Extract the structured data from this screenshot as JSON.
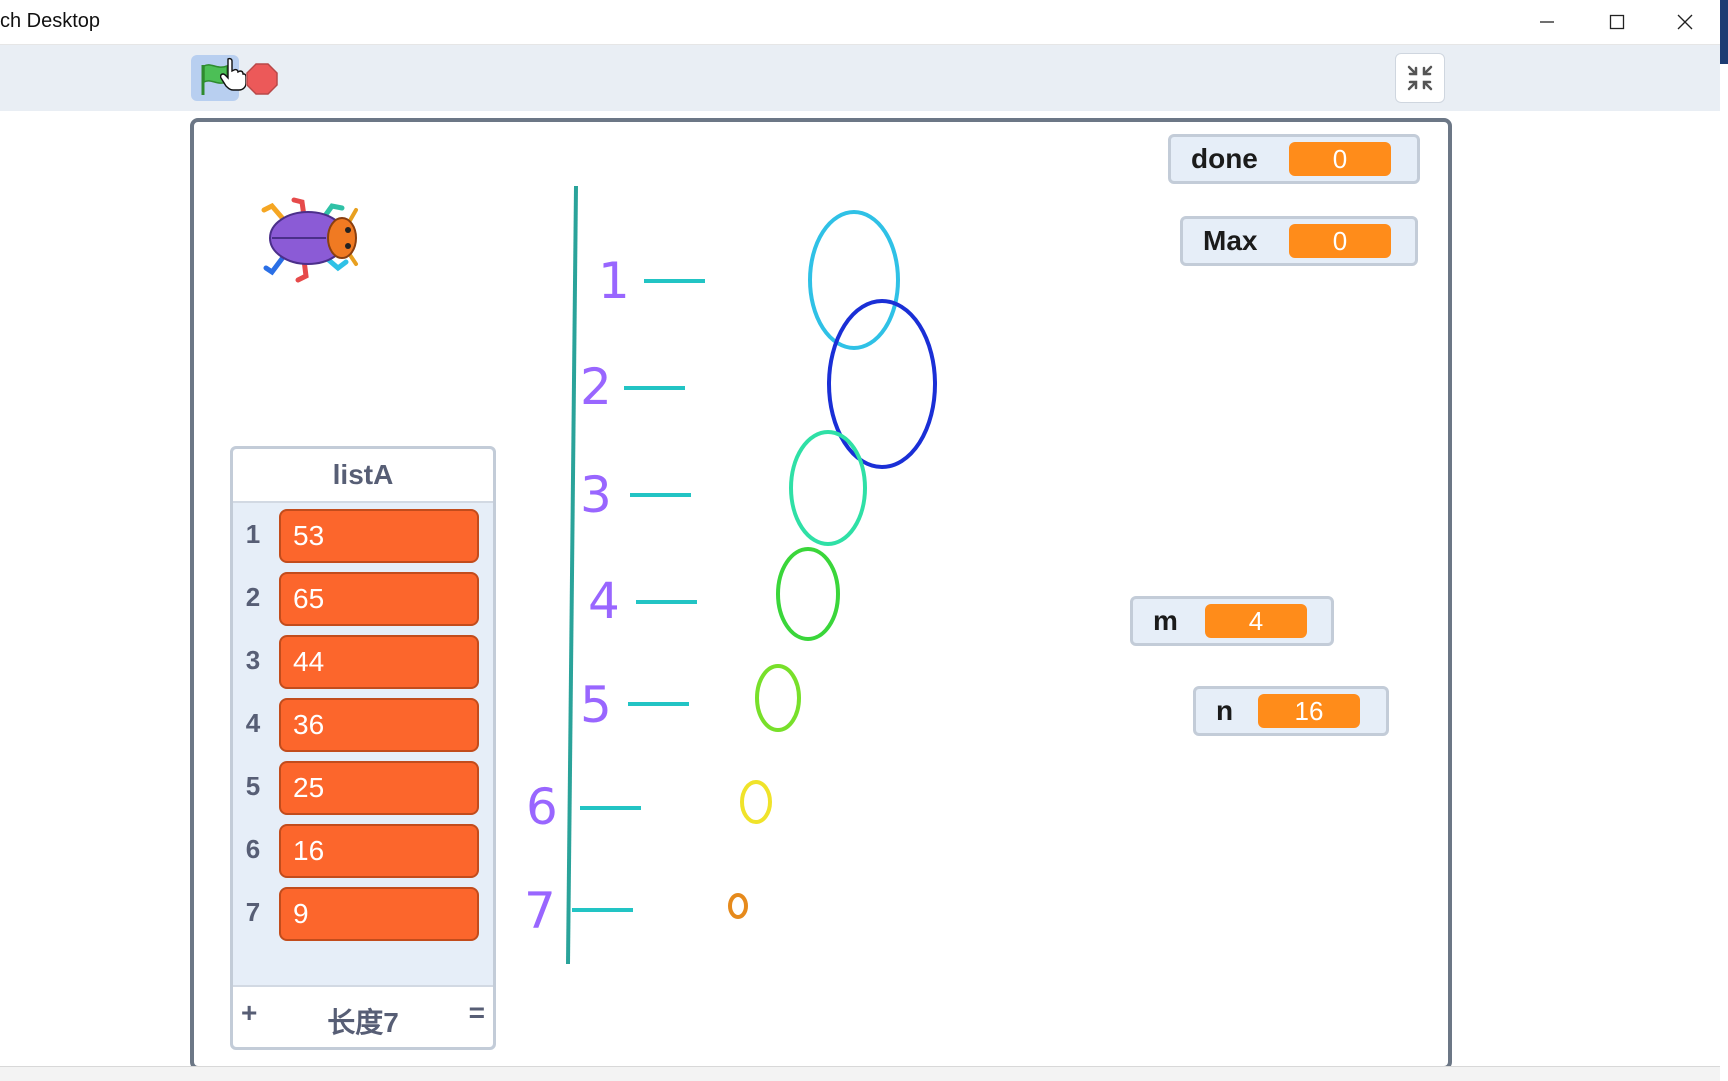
{
  "window": {
    "title": "ch Desktop"
  },
  "toolbar": {
    "green_flag": "green-flag-icon",
    "stop": "stop-icon",
    "unfullscreen": "unfullscreen-icon"
  },
  "monitors": {
    "done": {
      "label": "done",
      "value": "0"
    },
    "max": {
      "label": "Max",
      "value": "0"
    },
    "m": {
      "label": "m",
      "value": "4"
    },
    "n": {
      "label": "n",
      "value": "16"
    }
  },
  "list": {
    "title": "listA",
    "items": [
      {
        "index": "1",
        "value": "53"
      },
      {
        "index": "2",
        "value": "65"
      },
      {
        "index": "3",
        "value": "44"
      },
      {
        "index": "4",
        "value": "36"
      },
      {
        "index": "5",
        "value": "25"
      },
      {
        "index": "6",
        "value": "16"
      },
      {
        "index": "7",
        "value": "9"
      }
    ],
    "add_label": "+",
    "length_label": "长度7",
    "resize_label": "="
  },
  "stage": {
    "ruler_labels": [
      "1",
      "2",
      "3",
      "4",
      "5",
      "6",
      "7"
    ],
    "colors": {
      "label": "#9966ff",
      "tick": "#22c4c4",
      "axis": "#2aa39a"
    }
  }
}
